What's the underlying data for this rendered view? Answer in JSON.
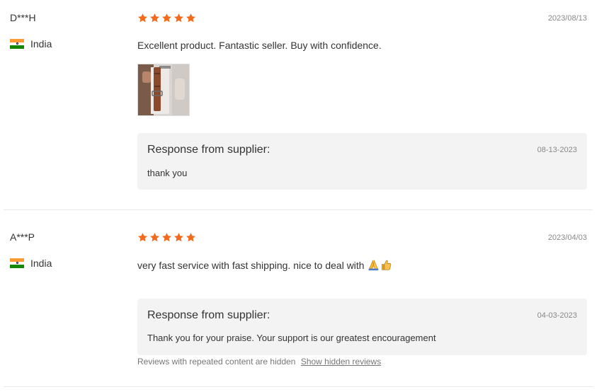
{
  "reviews": [
    {
      "buyer": "D***H",
      "country": "India",
      "rating": 5,
      "date": "2023/08/13",
      "content": "Excellent product. Fantastic seller. Buy with confidence.",
      "response_title": "Response from supplier:",
      "response_date": "08-13-2023",
      "response_text": "thank you"
    },
    {
      "buyer": "A***P",
      "country": "India",
      "rating": 5,
      "date": "2023/04/03",
      "content": "very fast service with fast shipping. nice to deal with",
      "content_emojis": [
        "folded-hands-icon",
        "thumbs-up-icon"
      ],
      "response_title": "Response from supplier:",
      "response_date": "04-03-2023",
      "response_text": "Thank you for your praise. Your support is our greatest encouragement"
    }
  ],
  "hidden_notice": {
    "text": "Reviews with repeated content are hidden",
    "link": "Show hidden reviews"
  },
  "colors": {
    "star": "#f26b1d",
    "response_bg": "#f3f3f3",
    "date_text": "#888888"
  }
}
